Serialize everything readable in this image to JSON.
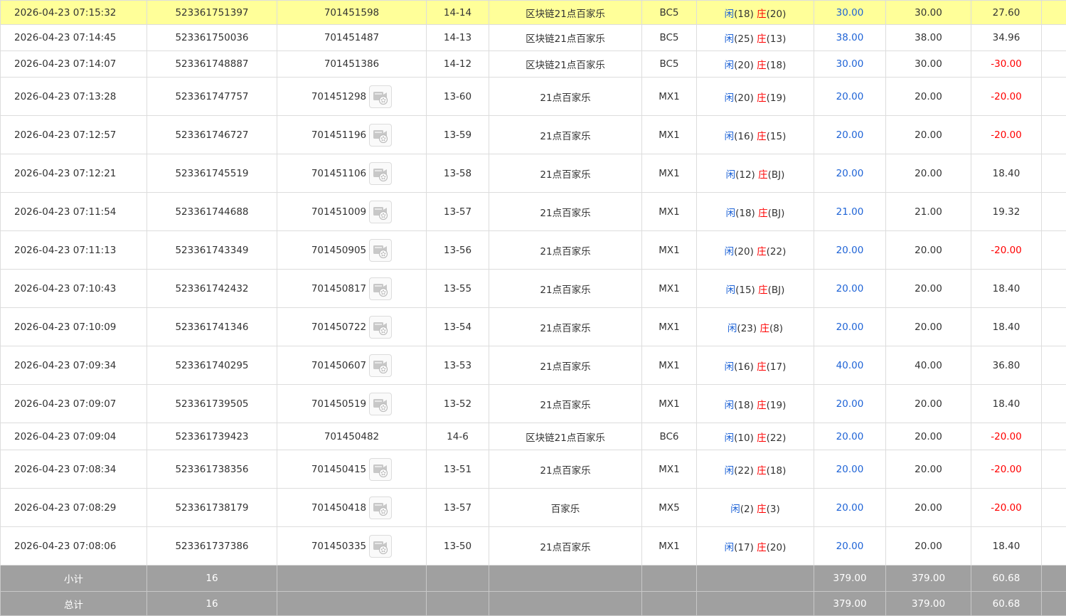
{
  "colors": {
    "bet_blue": "#1e63d6",
    "loss_red": "#ff0000",
    "highlight_row": "#ffff99",
    "summary_row": "#a0a0a0"
  },
  "rows": [
    {
      "time": "2026-04-23 07:15:32",
      "order_no": "523361751397",
      "game_no": "701451598",
      "has_video": false,
      "shoe": "14-14",
      "game": "区块链21点百家乐",
      "table": "BC5",
      "player_label": "闲",
      "player_val": "(18)",
      "banker_label": "庄",
      "banker_val": "(20)",
      "bet": "30.00",
      "valid": "30.00",
      "result": "27.60",
      "result_neg": false,
      "highlight": true
    },
    {
      "time": "2026-04-23 07:14:45",
      "order_no": "523361750036",
      "game_no": "701451487",
      "has_video": false,
      "shoe": "14-13",
      "game": "区块链21点百家乐",
      "table": "BC5",
      "player_label": "闲",
      "player_val": "(25)",
      "banker_label": "庄",
      "banker_val": "(13)",
      "bet": "38.00",
      "valid": "38.00",
      "result": "34.96",
      "result_neg": false,
      "highlight": false
    },
    {
      "time": "2026-04-23 07:14:07",
      "order_no": "523361748887",
      "game_no": "701451386",
      "has_video": false,
      "shoe": "14-12",
      "game": "区块链21点百家乐",
      "table": "BC5",
      "player_label": "闲",
      "player_val": "(20)",
      "banker_label": "庄",
      "banker_val": "(18)",
      "bet": "30.00",
      "valid": "30.00",
      "result": "-30.00",
      "result_neg": true,
      "highlight": false
    },
    {
      "time": "2026-04-23 07:13:28",
      "order_no": "523361747757",
      "game_no": "701451298",
      "has_video": true,
      "shoe": "13-60",
      "game": "21点百家乐",
      "table": "MX1",
      "player_label": "闲",
      "player_val": "(20)",
      "banker_label": "庄",
      "banker_val": "(19)",
      "bet": "20.00",
      "valid": "20.00",
      "result": "-20.00",
      "result_neg": true,
      "highlight": false
    },
    {
      "time": "2026-04-23 07:12:57",
      "order_no": "523361746727",
      "game_no": "701451196",
      "has_video": true,
      "shoe": "13-59",
      "game": "21点百家乐",
      "table": "MX1",
      "player_label": "闲",
      "player_val": "(16)",
      "banker_label": "庄",
      "banker_val": "(15)",
      "bet": "20.00",
      "valid": "20.00",
      "result": "-20.00",
      "result_neg": true,
      "highlight": false
    },
    {
      "time": "2026-04-23 07:12:21",
      "order_no": "523361745519",
      "game_no": "701451106",
      "has_video": true,
      "shoe": "13-58",
      "game": "21点百家乐",
      "table": "MX1",
      "player_label": "闲",
      "player_val": "(12)",
      "banker_label": "庄",
      "banker_val": "(BJ)",
      "bet": "20.00",
      "valid": "20.00",
      "result": "18.40",
      "result_neg": false,
      "highlight": false
    },
    {
      "time": "2026-04-23 07:11:54",
      "order_no": "523361744688",
      "game_no": "701451009",
      "has_video": true,
      "shoe": "13-57",
      "game": "21点百家乐",
      "table": "MX1",
      "player_label": "闲",
      "player_val": "(18)",
      "banker_label": "庄",
      "banker_val": "(BJ)",
      "bet": "21.00",
      "valid": "21.00",
      "result": "19.32",
      "result_neg": false,
      "highlight": false
    },
    {
      "time": "2026-04-23 07:11:13",
      "order_no": "523361743349",
      "game_no": "701450905",
      "has_video": true,
      "shoe": "13-56",
      "game": "21点百家乐",
      "table": "MX1",
      "player_label": "闲",
      "player_val": "(20)",
      "banker_label": "庄",
      "banker_val": "(22)",
      "bet": "20.00",
      "valid": "20.00",
      "result": "-20.00",
      "result_neg": true,
      "highlight": false
    },
    {
      "time": "2026-04-23 07:10:43",
      "order_no": "523361742432",
      "game_no": "701450817",
      "has_video": true,
      "shoe": "13-55",
      "game": "21点百家乐",
      "table": "MX1",
      "player_label": "闲",
      "player_val": "(15)",
      "banker_label": "庄",
      "banker_val": "(BJ)",
      "bet": "20.00",
      "valid": "20.00",
      "result": "18.40",
      "result_neg": false,
      "highlight": false
    },
    {
      "time": "2026-04-23 07:10:09",
      "order_no": "523361741346",
      "game_no": "701450722",
      "has_video": true,
      "shoe": "13-54",
      "game": "21点百家乐",
      "table": "MX1",
      "player_label": "闲",
      "player_val": "(23)",
      "banker_label": "庄",
      "banker_val": "(8)",
      "bet": "20.00",
      "valid": "20.00",
      "result": "18.40",
      "result_neg": false,
      "highlight": false
    },
    {
      "time": "2026-04-23 07:09:34",
      "order_no": "523361740295",
      "game_no": "701450607",
      "has_video": true,
      "shoe": "13-53",
      "game": "21点百家乐",
      "table": "MX1",
      "player_label": "闲",
      "player_val": "(16)",
      "banker_label": "庄",
      "banker_val": "(17)",
      "bet": "40.00",
      "valid": "40.00",
      "result": "36.80",
      "result_neg": false,
      "highlight": false
    },
    {
      "time": "2026-04-23 07:09:07",
      "order_no": "523361739505",
      "game_no": "701450519",
      "has_video": true,
      "shoe": "13-52",
      "game": "21点百家乐",
      "table": "MX1",
      "player_label": "闲",
      "player_val": "(18)",
      "banker_label": "庄",
      "banker_val": "(19)",
      "bet": "20.00",
      "valid": "20.00",
      "result": "18.40",
      "result_neg": false,
      "highlight": false
    },
    {
      "time": "2026-04-23 07:09:04",
      "order_no": "523361739423",
      "game_no": "701450482",
      "has_video": false,
      "shoe": "14-6",
      "game": "区块链21点百家乐",
      "table": "BC6",
      "player_label": "闲",
      "player_val": "(10)",
      "banker_label": "庄",
      "banker_val": "(22)",
      "bet": "20.00",
      "valid": "20.00",
      "result": "-20.00",
      "result_neg": true,
      "highlight": false
    },
    {
      "time": "2026-04-23 07:08:34",
      "order_no": "523361738356",
      "game_no": "701450415",
      "has_video": true,
      "shoe": "13-51",
      "game": "21点百家乐",
      "table": "MX1",
      "player_label": "闲",
      "player_val": "(22)",
      "banker_label": "庄",
      "banker_val": "(18)",
      "bet": "20.00",
      "valid": "20.00",
      "result": "-20.00",
      "result_neg": true,
      "highlight": false
    },
    {
      "time": "2026-04-23 07:08:29",
      "order_no": "523361738179",
      "game_no": "701450418",
      "has_video": true,
      "shoe": "13-57",
      "game": "百家乐",
      "table": "MX5",
      "player_label": "闲",
      "player_val": "(2)",
      "banker_label": "庄",
      "banker_val": "(3)",
      "bet": "20.00",
      "valid": "20.00",
      "result": "-20.00",
      "result_neg": true,
      "highlight": false
    },
    {
      "time": "2026-04-23 07:08:06",
      "order_no": "523361737386",
      "game_no": "701450335",
      "has_video": true,
      "shoe": "13-50",
      "game": "21点百家乐",
      "table": "MX1",
      "player_label": "闲",
      "player_val": "(17)",
      "banker_label": "庄",
      "banker_val": "(20)",
      "bet": "20.00",
      "valid": "20.00",
      "result": "18.40",
      "result_neg": false,
      "highlight": false
    }
  ],
  "summary": [
    {
      "label": "小计",
      "count": "16",
      "bet": "379.00",
      "valid": "379.00",
      "result": "60.68"
    },
    {
      "label": "总计",
      "count": "16",
      "bet": "379.00",
      "valid": "379.00",
      "result": "60.68"
    }
  ]
}
